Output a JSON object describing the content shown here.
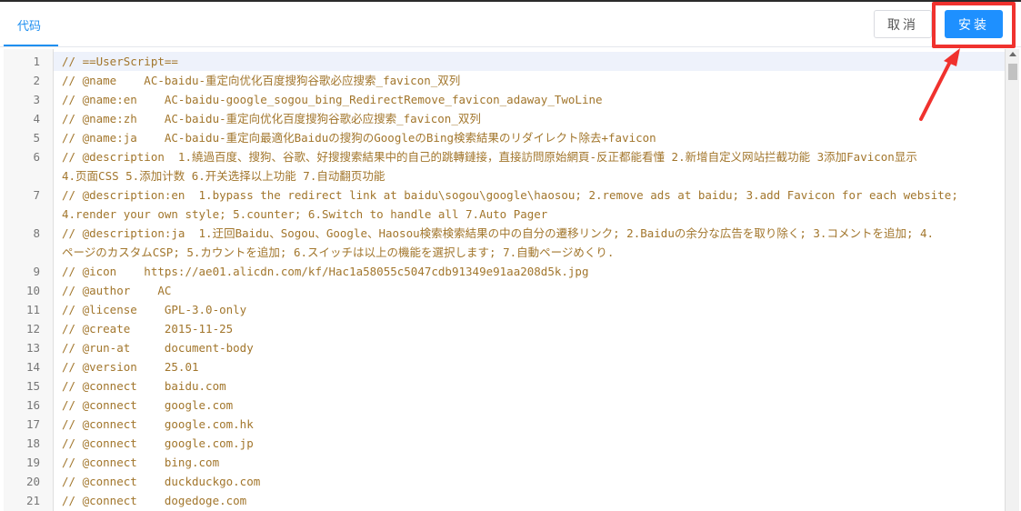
{
  "tabs": [
    {
      "label": "代码"
    }
  ],
  "buttons": {
    "cancel_label": "取消",
    "install_label": "安装"
  },
  "colors": {
    "accent": "#1e90ff",
    "annotation": "#f0322e",
    "comment_text": "#a2762c"
  },
  "editor": {
    "active_line": 1,
    "lines": [
      {
        "num": "1",
        "text": "// ==UserScript=="
      },
      {
        "num": "2",
        "text": "// @name    AC-baidu-重定向优化百度搜狗谷歌必应搜索_favicon_双列"
      },
      {
        "num": "3",
        "text": "// @name:en    AC-baidu-google_sogou_bing_RedirectRemove_favicon_adaway_TwoLine"
      },
      {
        "num": "4",
        "text": "// @name:zh    AC-baidu-重定向优化百度搜狗谷歌必应搜索_favicon_双列"
      },
      {
        "num": "5",
        "text": "// @name:ja    AC-baidu-重定向最適化Baiduの搜狗のGoogleのBing検索結果のリダイレクト除去+favicon"
      },
      {
        "num": "6",
        "text": "// @description  1.繞過百度、搜狗、谷歌、好搜搜索結果中的自己的跳轉鏈接，直接訪問原始網頁-反正都能看懂 2.新增自定义网站拦截功能 3添加Favicon显示"
      },
      {
        "num": "",
        "text": "4.页面CSS 5.添加计数 6.开关选择以上功能 7.自动翻页功能"
      },
      {
        "num": "7",
        "text": "// @description:en  1.bypass the redirect link at baidu\\sogou\\google\\haosou; 2.remove ads at baidu; 3.add Favicon for each website;"
      },
      {
        "num": "",
        "text": "4.render your own style; 5.counter; 6.Switch to handle all 7.Auto Pager"
      },
      {
        "num": "8",
        "text": "// @description:ja  1.迂回Baidu、Sogou、Google、Haosou検索検索結果の中の自分の遷移リンク; 2.Baiduの余分な広告を取り除く; 3.コメントを追加; 4."
      },
      {
        "num": "",
        "text": "ページのカスタムCSP; 5.カウントを追加; 6.スイッチは以上の機能を選択します; 7.自動ページめくり."
      },
      {
        "num": "9",
        "text": "// @icon    https://ae01.alicdn.com/kf/Hac1a58055c5047cdb91349e91aa208d5k.jpg"
      },
      {
        "num": "10",
        "text": "// @author    AC"
      },
      {
        "num": "11",
        "text": "// @license    GPL-3.0-only"
      },
      {
        "num": "12",
        "text": "// @create     2015-11-25"
      },
      {
        "num": "13",
        "text": "// @run-at     document-body"
      },
      {
        "num": "14",
        "text": "// @version    25.01"
      },
      {
        "num": "15",
        "text": "// @connect    baidu.com"
      },
      {
        "num": "16",
        "text": "// @connect    google.com"
      },
      {
        "num": "17",
        "text": "// @connect    google.com.hk"
      },
      {
        "num": "18",
        "text": "// @connect    google.com.jp"
      },
      {
        "num": "19",
        "text": "// @connect    bing.com"
      },
      {
        "num": "20",
        "text": "// @connect    duckduckgo.com"
      },
      {
        "num": "21",
        "text": "// @connect    dogedoge.com"
      }
    ]
  }
}
